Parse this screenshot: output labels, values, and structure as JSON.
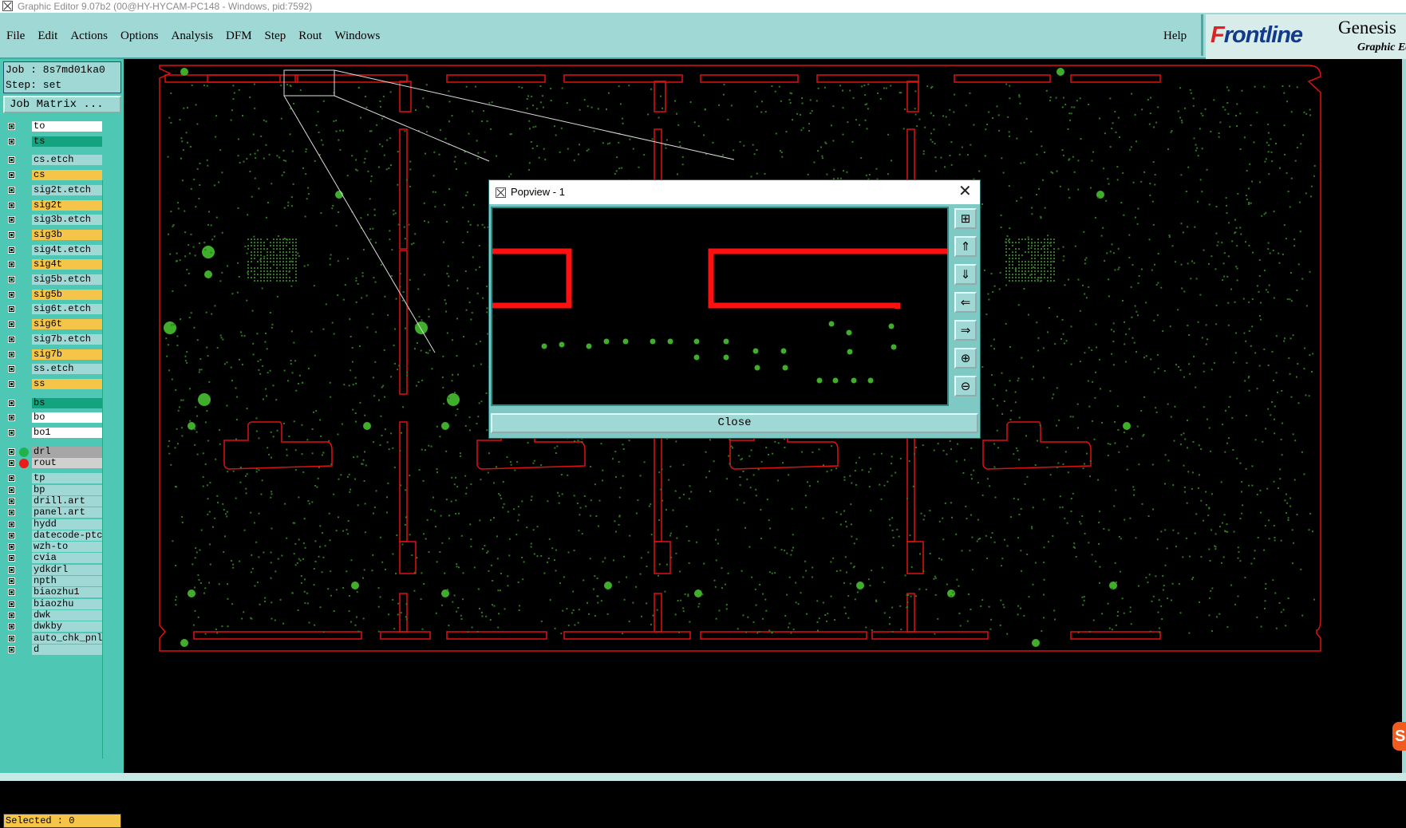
{
  "window": {
    "title": "Graphic Editor 9.07b2 (00@HY-HYCAM-PC148 - Windows, pid:7592)"
  },
  "menubar": {
    "items": [
      "File",
      "Edit",
      "Actions",
      "Options",
      "Analysis",
      "DFM",
      "Step",
      "Rout",
      "Windows"
    ],
    "help": "Help"
  },
  "brand": {
    "logo_f": "F",
    "logo_rest": "rontline",
    "product": "Genesis",
    "subtitle": "Graphic Ed"
  },
  "job": {
    "job_line": "Job : 8s7md01ka0",
    "step_line": "Step: set",
    "matrix_button": "Job Matrix ..."
  },
  "layers": [
    {
      "name": "to",
      "color": "#ffffff"
    },
    {
      "name": "ts",
      "color": "#14a37f"
    },
    {
      "name": "cs.etch",
      "color": "#9fd8d5"
    },
    {
      "name": "cs",
      "color": "#f5c54a"
    },
    {
      "name": "sig2t.etch",
      "color": "#9fd8d5"
    },
    {
      "name": "sig2t",
      "color": "#f5c54a"
    },
    {
      "name": "sig3b.etch",
      "color": "#9fd8d5"
    },
    {
      "name": "sig3b",
      "color": "#f5c54a"
    },
    {
      "name": "sig4t.etch",
      "color": "#9fd8d5"
    },
    {
      "name": "sig4t",
      "color": "#f5c54a"
    },
    {
      "name": "sig5b.etch",
      "color": "#9fd8d5"
    },
    {
      "name": "sig5b",
      "color": "#f5c54a"
    },
    {
      "name": "sig6t.etch",
      "color": "#9fd8d5"
    },
    {
      "name": "sig6t",
      "color": "#f5c54a"
    },
    {
      "name": "sig7b.etch",
      "color": "#9fd8d5"
    },
    {
      "name": "sig7b",
      "color": "#f5c54a"
    },
    {
      "name": "ss.etch",
      "color": "#9fd8d5"
    },
    {
      "name": "ss",
      "color": "#f5c54a"
    },
    {
      "name": "bs",
      "color": "#14a37f"
    },
    {
      "name": "bo",
      "color": "#ffffff"
    },
    {
      "name": "bo1",
      "color": "#ffffff"
    },
    {
      "name": "drl",
      "color": "#a6a6a6",
      "dot": "#21b24b"
    },
    {
      "name": "rout",
      "color": "#d0d0d0",
      "dot": "#e81c1c"
    },
    {
      "name": "tp",
      "color": "#9fd8d5"
    },
    {
      "name": "bp",
      "color": "#9fd8d5"
    },
    {
      "name": "drill.art",
      "color": "#9fd8d5"
    },
    {
      "name": "panel.art",
      "color": "#9fd8d5"
    },
    {
      "name": "hydd",
      "color": "#9fd8d5"
    },
    {
      "name": "datecode-ptc",
      "color": "#9fd8d5"
    },
    {
      "name": "wzh-to",
      "color": "#9fd8d5"
    },
    {
      "name": "cvia",
      "color": "#9fd8d5"
    },
    {
      "name": "ydkdrl",
      "color": "#9fd8d5"
    },
    {
      "name": "npth",
      "color": "#9fd8d5"
    },
    {
      "name": "biaozhu1",
      "color": "#9fd8d5"
    },
    {
      "name": "biaozhu",
      "color": "#9fd8d5"
    },
    {
      "name": "dwk",
      "color": "#9fd8d5"
    },
    {
      "name": "dwkby",
      "color": "#9fd8d5"
    },
    {
      "name": "auto_chk_pnl",
      "color": "#9fd8d5"
    },
    {
      "name": "d",
      "color": "#9fd8d5"
    }
  ],
  "status": {
    "selected": "Selected : 0"
  },
  "popview": {
    "title": "Popview - 1",
    "close_label": "Close",
    "close_x": "✕",
    "tools": [
      "zoom-fit-icon",
      "pan-up-icon",
      "pan-down-icon",
      "pan-left-icon",
      "pan-right-icon",
      "zoom-in-icon",
      "zoom-out-icon"
    ]
  },
  "colors": {
    "rout": "#e01010",
    "drill": "#3fae2a",
    "pad": "#2f7a1e",
    "menu_bg": "#9fd8d5",
    "panel_bg": "#4ec8b4"
  }
}
